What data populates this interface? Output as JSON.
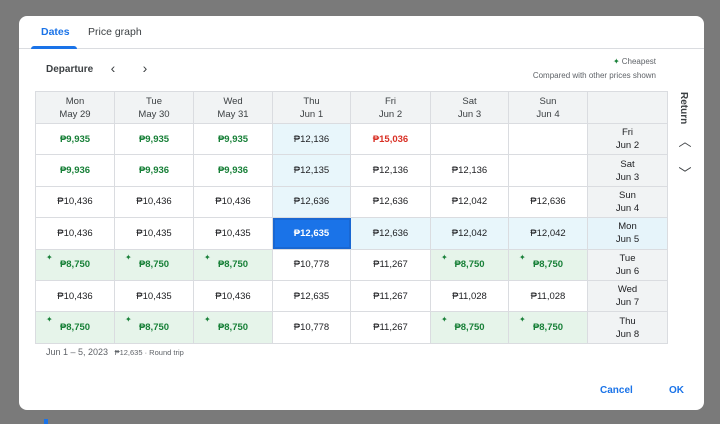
{
  "tabs": [
    {
      "label": "Dates"
    },
    {
      "label": "Price graph"
    }
  ],
  "departure_label": "Departure",
  "legend": {
    "cheapest": "Cheapest",
    "note": "Compared with other prices shown"
  },
  "return_label": "Return",
  "columns": [
    {
      "day": "Mon",
      "date": "May 29"
    },
    {
      "day": "Tue",
      "date": "May 30"
    },
    {
      "day": "Wed",
      "date": "May 31"
    },
    {
      "day": "Thu",
      "date": "Jun 1"
    },
    {
      "day": "Fri",
      "date": "Jun 2"
    },
    {
      "day": "Sat",
      "date": "Jun 3"
    },
    {
      "day": "Sun",
      "date": "Jun 4"
    }
  ],
  "rows": [
    {
      "day": "Fri",
      "date": "Jun 2",
      "cells": [
        {
          "price": "₱9,935",
          "kind": "cheap"
        },
        {
          "price": "₱9,935",
          "kind": "cheap"
        },
        {
          "price": "₱9,935",
          "kind": "cheap"
        },
        {
          "price": "₱12,136",
          "kind": "hl"
        },
        {
          "price": "₱15,036",
          "kind": "high"
        },
        {
          "price": "",
          "kind": "empty"
        },
        {
          "price": "",
          "kind": "empty"
        }
      ]
    },
    {
      "day": "Sat",
      "date": "Jun 3",
      "cells": [
        {
          "price": "₱9,936",
          "kind": "cheap"
        },
        {
          "price": "₱9,936",
          "kind": "cheap"
        },
        {
          "price": "₱9,936",
          "kind": "cheap"
        },
        {
          "price": "₱12,135",
          "kind": "hl"
        },
        {
          "price": "₱12,136",
          "kind": "normal"
        },
        {
          "price": "₱12,136",
          "kind": "normal"
        },
        {
          "price": "",
          "kind": "empty"
        }
      ]
    },
    {
      "day": "Sun",
      "date": "Jun 4",
      "cells": [
        {
          "price": "₱10,436",
          "kind": "normal"
        },
        {
          "price": "₱10,436",
          "kind": "normal"
        },
        {
          "price": "₱10,436",
          "kind": "normal"
        },
        {
          "price": "₱12,636",
          "kind": "hl"
        },
        {
          "price": "₱12,636",
          "kind": "normal"
        },
        {
          "price": "₱12,042",
          "kind": "normal"
        },
        {
          "price": "₱12,636",
          "kind": "normal"
        }
      ]
    },
    {
      "day": "Mon",
      "date": "Jun 5",
      "cells": [
        {
          "price": "₱10,436",
          "kind": "normal"
        },
        {
          "price": "₱10,435",
          "kind": "normal"
        },
        {
          "price": "₱10,435",
          "kind": "normal"
        },
        {
          "price": "₱12,635",
          "kind": "sel"
        },
        {
          "price": "₱12,636",
          "kind": "hl"
        },
        {
          "price": "₱12,042",
          "kind": "hl"
        },
        {
          "price": "₱12,042",
          "kind": "hl"
        }
      ]
    },
    {
      "day": "Tue",
      "date": "Jun 6",
      "cells": [
        {
          "price": "₱8,750",
          "kind": "best"
        },
        {
          "price": "₱8,750",
          "kind": "best"
        },
        {
          "price": "₱8,750",
          "kind": "best"
        },
        {
          "price": "₱10,778",
          "kind": "normal"
        },
        {
          "price": "₱11,267",
          "kind": "normal"
        },
        {
          "price": "₱8,750",
          "kind": "best"
        },
        {
          "price": "₱8,750",
          "kind": "best"
        }
      ]
    },
    {
      "day": "Wed",
      "date": "Jun 7",
      "cells": [
        {
          "price": "₱10,436",
          "kind": "normal"
        },
        {
          "price": "₱10,435",
          "kind": "normal"
        },
        {
          "price": "₱10,436",
          "kind": "normal"
        },
        {
          "price": "₱12,635",
          "kind": "normal"
        },
        {
          "price": "₱11,267",
          "kind": "normal"
        },
        {
          "price": "₱11,028",
          "kind": "normal"
        },
        {
          "price": "₱11,028",
          "kind": "normal"
        }
      ]
    },
    {
      "day": "Thu",
      "date": "Jun 8",
      "cells": [
        {
          "price": "₱8,750",
          "kind": "best"
        },
        {
          "price": "₱8,750",
          "kind": "best"
        },
        {
          "price": "₱8,750",
          "kind": "best"
        },
        {
          "price": "₱10,778",
          "kind": "normal"
        },
        {
          "price": "₱11,267",
          "kind": "normal"
        },
        {
          "price": "₱8,750",
          "kind": "best"
        },
        {
          "price": "₱8,750",
          "kind": "best"
        }
      ]
    }
  ],
  "summary": {
    "dates": "Jun 1 – 5, 2023",
    "detail": "₱12,635 · Round trip"
  },
  "buttons": {
    "cancel": "Cancel",
    "ok": "OK"
  },
  "colors": {
    "accent": "#1a73e8",
    "cheap": "#188038",
    "expensive": "#d93025",
    "cheap_bg": "#e6f4ea",
    "highlight_bg": "#e8f6fb"
  }
}
